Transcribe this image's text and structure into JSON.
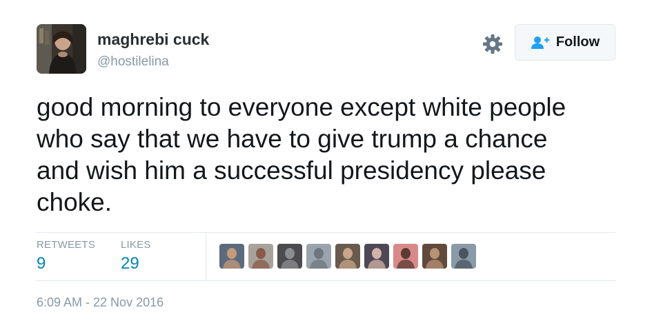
{
  "author": {
    "name": "maghrebi cuck",
    "handle": "@hostilelina"
  },
  "header": {
    "settings_icon": "gear-icon",
    "follow_label": "Follow",
    "follow_icon": "add-user-icon"
  },
  "tweet": {
    "lines": [
      "good morning to everyone except white people",
      "who say that we have to give trump a chance",
      "and wish him a successful presidency please",
      "choke."
    ]
  },
  "stats": {
    "retweets_label": "RETWEETS",
    "retweets_value": "9",
    "likes_label": "LIKES",
    "likes_value": "29"
  },
  "liker_avatars": [
    {
      "name": "liker-avatar-1",
      "bg": "#5b6a7c",
      "fg": "#c59a7a"
    },
    {
      "name": "liker-avatar-2",
      "bg": "#a8a29c",
      "fg": "#8a5a48"
    },
    {
      "name": "liker-avatar-3",
      "bg": "#4c4b4e",
      "fg": "#8c8d92"
    },
    {
      "name": "liker-avatar-4",
      "bg": "#9ba4ad",
      "fg": "#6e7680"
    },
    {
      "name": "liker-avatar-5",
      "bg": "#6a5a4e",
      "fg": "#c7a588"
    },
    {
      "name": "liker-avatar-6",
      "bg": "#4e4756",
      "fg": "#d3b3a8"
    },
    {
      "name": "liker-avatar-7",
      "bg": "#d88a8a",
      "fg": "#5a3a32"
    },
    {
      "name": "liker-avatar-8",
      "bg": "#5f4a3c",
      "fg": "#b89274"
    },
    {
      "name": "liker-avatar-9",
      "bg": "#8a9aa8",
      "fg": "#4a5560"
    }
  ],
  "timestamp": "6:09 AM - 22 Nov 2016",
  "colors": {
    "text": "#14171a",
    "muted": "#8899a6",
    "count_blue": "#0084b4",
    "border": "#e1e8ed",
    "button_bg": "#f5f8fa",
    "follow_icon_blue": "#1da1f2"
  }
}
